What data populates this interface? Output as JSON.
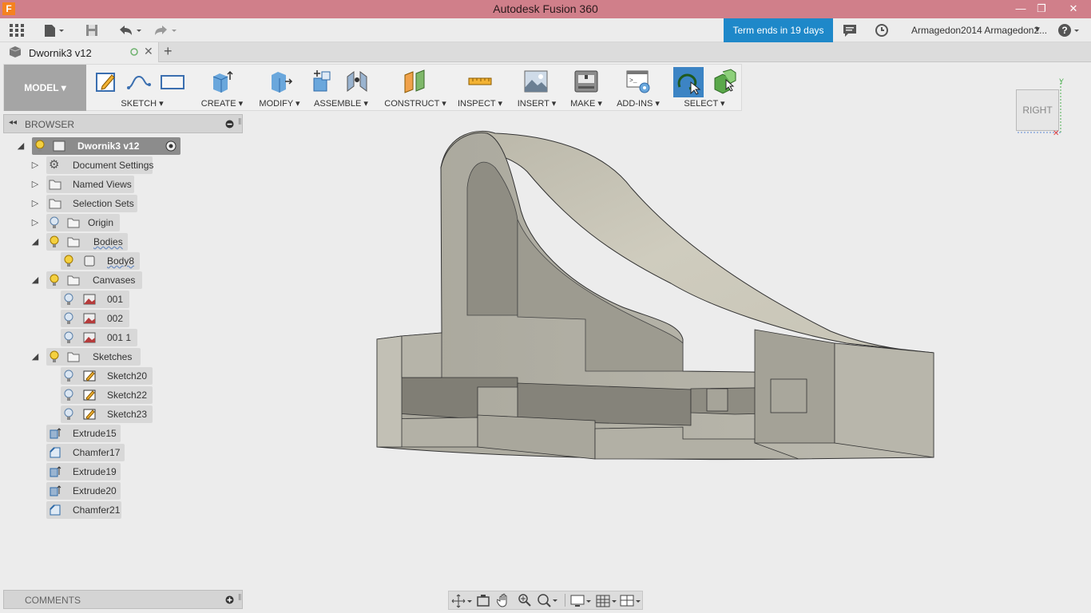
{
  "window": {
    "title": "Autodesk Fusion 360",
    "logo_letter": "F",
    "controls": [
      "—",
      "❐",
      "✕"
    ]
  },
  "toolbar": {
    "term_notice": "Term ends in 19 days",
    "user": "Armagedon2014 Armagedon2...",
    "help": "?"
  },
  "tab": {
    "name": "Dwornik3 v12",
    "add": "+"
  },
  "ribbon": {
    "workspace": "MODEL ▾",
    "groups": [
      "SKETCH ▾",
      "CREATE ▾",
      "MODIFY ▾",
      "ASSEMBLE ▾",
      "CONSTRUCT ▾",
      "INSPECT ▾",
      "INSERT ▾",
      "MAKE ▾",
      "ADD-INS ▾",
      "SELECT ▾"
    ]
  },
  "browser": {
    "title": "BROWSER",
    "root": "Dwornik3 v12",
    "items": {
      "document_settings": "Document Settings",
      "named_views": "Named Views",
      "selection_sets": "Selection Sets",
      "origin": "Origin",
      "bodies": "Bodies",
      "body8": "Body8",
      "canvases": "Canvases",
      "canvas1": "001",
      "canvas2": "002",
      "canvas3": "001 1",
      "sketches": "Sketches",
      "sketch20": "Sketch20",
      "sketch22": "Sketch22",
      "sketch23": "Sketch23"
    },
    "timeline": [
      "Extrude15",
      "Chamfer17",
      "Extrude19",
      "Extrude20",
      "Chamfer21"
    ]
  },
  "comments": {
    "title": "COMMENTS"
  },
  "viewcube": {
    "face": "RIGHT"
  },
  "colors": {
    "titlebar": "#d07f8a",
    "accent": "#1e88c9",
    "model_bg": "#a5a5a5",
    "select_active": "#3c84c4"
  }
}
